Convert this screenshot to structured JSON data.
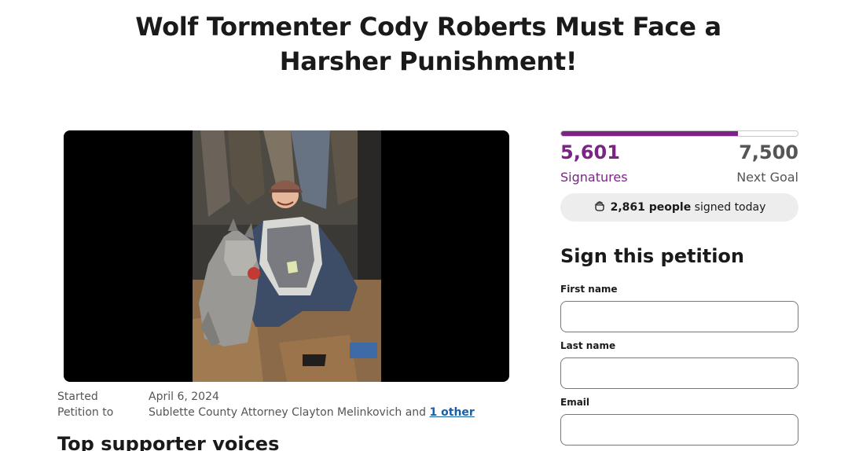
{
  "petition": {
    "title": "Wolf Tormenter Cody Roberts Must Face a Harsher Punishment!",
    "started_label": "Started",
    "started_value": "April 6, 2024",
    "petition_to_label": "Petition to",
    "petition_to_value": "Sublette County Attorney Clayton Melinkovich and ",
    "petition_to_link": "1 other",
    "voices_heading": "Top supporter voices"
  },
  "progress": {
    "signatures": "5,601",
    "signatures_label": "Signatures",
    "goal": "7,500",
    "goal_label": "Next Goal",
    "fraction": 0.7468,
    "today_count": "2,861 people",
    "today_suffix": "signed today"
  },
  "form": {
    "heading": "Sign this petition",
    "first_name_label": "First name",
    "last_name_label": "Last name",
    "email_label": "Email",
    "first_name_value": "",
    "last_name_value": "",
    "email_value": ""
  },
  "colors": {
    "accent": "#7b2486",
    "link": "#1a5fa6",
    "pill_bg": "#ededed"
  },
  "icons": {
    "today": "fist-icon"
  }
}
